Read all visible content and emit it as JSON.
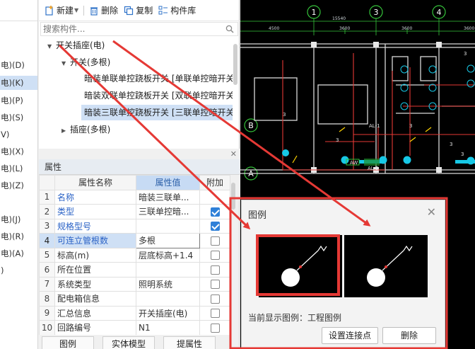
{
  "left_categories": [
    {
      "label": "电)(D)",
      "active": false
    },
    {
      "label": "电)(K)",
      "active": true
    },
    {
      "label": "电)(P)",
      "active": false
    },
    {
      "label": "电)(S)",
      "active": false
    },
    {
      "label": "V)",
      "active": false
    },
    {
      "label": "电)(X)",
      "active": false
    },
    {
      "label": "电)(L)",
      "active": false
    },
    {
      "label": "电)(Z)",
      "active": false
    },
    {
      "label": "",
      "active": false
    },
    {
      "label": "电)(J)",
      "active": false
    },
    {
      "label": "电)(R)",
      "active": false
    },
    {
      "label": "电)(A)",
      "active": false
    },
    {
      "label": ")",
      "active": false
    }
  ],
  "toolbar": {
    "new_label": "新建",
    "delete_label": "删除",
    "copy_label": "复制",
    "library_label": "构件库"
  },
  "search": {
    "placeholder": "搜索构件..."
  },
  "tree": [
    {
      "label": "开关插座(电)",
      "level": 0,
      "arrow": "▼",
      "selected": false
    },
    {
      "label": "开关(多根)",
      "level": 1,
      "arrow": "▼",
      "selected": false
    },
    {
      "label": "暗装单联单控跷板开关 [单联单控暗开关",
      "level": 2,
      "arrow": "",
      "selected": false
    },
    {
      "label": "暗装双联单控跷板开关 [双联单控暗开关",
      "level": 2,
      "arrow": "",
      "selected": false
    },
    {
      "label": "暗装三联单控跷板开关 [三联单控暗开关",
      "level": 2,
      "arrow": "",
      "selected": true
    },
    {
      "label": "插座(多根)",
      "level": 1,
      "arrow": "▶",
      "selected": false
    }
  ],
  "attributes": {
    "title": "属性",
    "col_name": "属性名称",
    "col_value": "属性值",
    "col_extra": "附加",
    "rows": [
      {
        "no": "1",
        "name": "名称",
        "value": "暗装三联单...",
        "blue": true,
        "check": null
      },
      {
        "no": "2",
        "name": "类型",
        "value": "三联单控暗...",
        "blue": true,
        "check": true
      },
      {
        "no": "3",
        "name": "规格型号",
        "value": "",
        "blue": true,
        "check": true
      },
      {
        "no": "4",
        "name": "可连立管根数",
        "value": "多根",
        "blue": true,
        "check": false,
        "editing": true
      },
      {
        "no": "5",
        "name": "标高(m)",
        "value": "层底标高+1.4",
        "blue": false,
        "check": false
      },
      {
        "no": "6",
        "name": "所在位置",
        "value": "",
        "blue": false,
        "check": false
      },
      {
        "no": "7",
        "name": "系统类型",
        "value": "照明系统",
        "blue": false,
        "check": false
      },
      {
        "no": "8",
        "name": "配电箱信息",
        "value": "",
        "blue": false,
        "check": false
      },
      {
        "no": "9",
        "name": "汇总信息",
        "value": "开关插座(电)",
        "blue": false,
        "check": false
      },
      {
        "no": "10",
        "name": "回路编号",
        "value": "N1",
        "blue": false,
        "check": false
      }
    ]
  },
  "bottom_tabs": {
    "legend": "图例",
    "solid_model": "实体模型",
    "extract": "提属性"
  },
  "cad": {
    "axis_labels": [
      "1",
      "3",
      "4",
      "B",
      "A"
    ],
    "dims": [
      "15540",
      "4500",
      "3600",
      "3600",
      "3600"
    ],
    "texts": [
      "3",
      "3",
      "3",
      "3",
      "AL-1",
      "AL-3",
      "AW",
      "3",
      "3"
    ]
  },
  "legend_dialog": {
    "title": "图例",
    "current_label": "当前显示图例：工程图例",
    "set_point_button": "设置连接点",
    "delete_button": "删除"
  },
  "colors": {
    "highlight": "#cfe0f5",
    "annotation_red": "#e53935",
    "link_blue": "#2a62c6"
  }
}
